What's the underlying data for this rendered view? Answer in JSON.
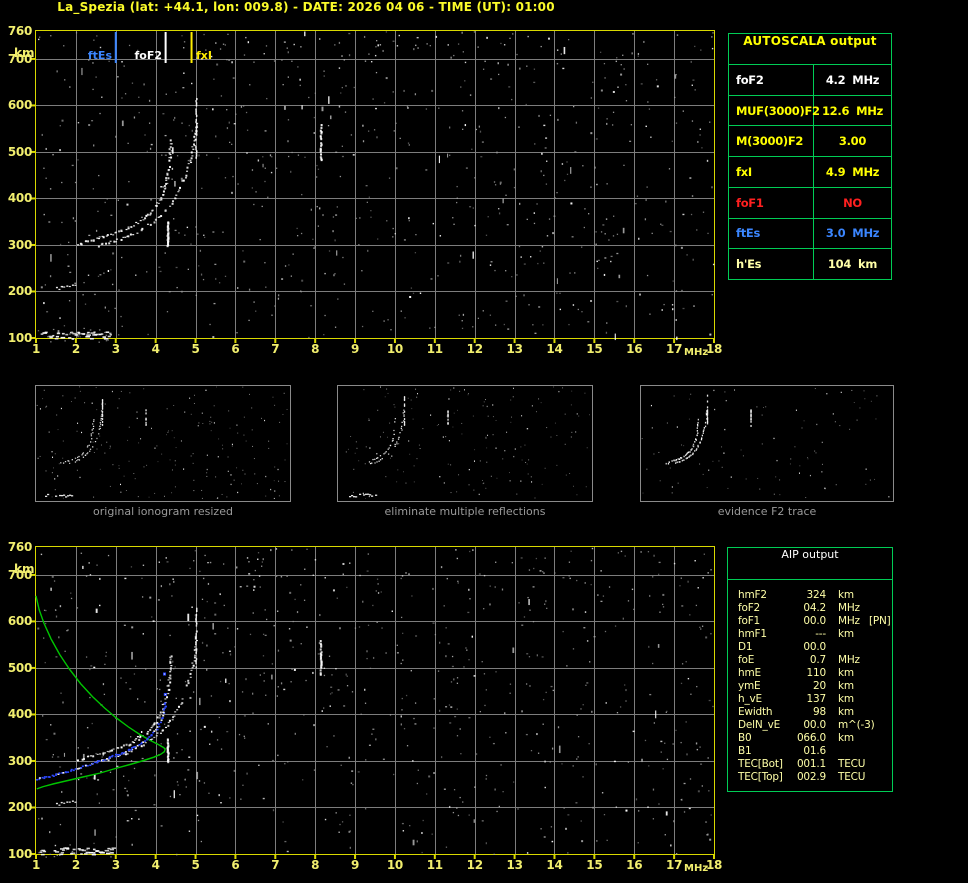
{
  "header": {
    "title": "La_Spezia (lat: +44.1, lon: 009.8) - DATE: 2026 04 06 - TIME (UT): 01:00"
  },
  "colors": {
    "background": "#000000",
    "title_yellow": "#fbfb2a",
    "axis_label_yellow": "#f1ee6e",
    "plot_border_yellow": "#d9d900",
    "grid_gray": "#7d7d7d",
    "table_border_green": "#00cc55",
    "table_yellow": "#ffff00",
    "pale_yellow": "#ffffa8",
    "alert_red": "#ff2020",
    "marker_blue": "#3b86ff",
    "profile_green": "#00c400",
    "trace_blue": "#2e49ff",
    "caption_gray": "#9a9a9a",
    "trace_white": "#ffffff"
  },
  "autoscala": {
    "title": "AUTOSCALA output",
    "rows": [
      {
        "label": "foF2",
        "value": "4.2",
        "unit": "MHz",
        "color": "#ffffff"
      },
      {
        "label": "MUF(3000)F2",
        "value": "12.6",
        "unit": "MHz",
        "color": "#ffff00"
      },
      {
        "label": "M(3000)F2",
        "value": "3.00",
        "unit": "",
        "color": "#ffff00"
      },
      {
        "label": "fxI",
        "value": "4.9",
        "unit": "MHz",
        "color": "#ffff00"
      },
      {
        "label": "foF1",
        "value": "NO",
        "unit": "",
        "color": "#ff2020"
      },
      {
        "label": "ftEs",
        "value": "3.0",
        "unit": "MHz",
        "color": "#3b86ff"
      },
      {
        "label": "h'Es",
        "value": "104",
        "unit": "km",
        "color": "#ffffa8"
      }
    ]
  },
  "aip": {
    "title": "AIP output",
    "rows": [
      {
        "label": "hmF2",
        "value": "324",
        "unit": "km",
        "note": ""
      },
      {
        "label": "foF2",
        "value": "04.2",
        "unit": "MHz",
        "note": ""
      },
      {
        "label": "foF1",
        "value": "00.0",
        "unit": "MHz",
        "note": "[PN]"
      },
      {
        "label": "hmF1",
        "value": "---",
        "unit": "km",
        "note": ""
      },
      {
        "label": "D1",
        "value": "00.0",
        "unit": "",
        "note": ""
      },
      {
        "label": "foE",
        "value": "0.7",
        "unit": "MHz",
        "note": ""
      },
      {
        "label": "hmE",
        "value": "110",
        "unit": "km",
        "note": ""
      },
      {
        "label": "ymE",
        "value": "20",
        "unit": "km",
        "note": ""
      },
      {
        "label": "h_vE",
        "value": "137",
        "unit": "km",
        "note": ""
      },
      {
        "label": "Ewidth",
        "value": "98",
        "unit": "km",
        "note": ""
      },
      {
        "label": "DelN_vE",
        "value": "00.0",
        "unit": "m^(-3)",
        "note": ""
      },
      {
        "label": "B0",
        "value": "066.0",
        "unit": "km",
        "note": ""
      },
      {
        "label": "B1",
        "value": "01.6",
        "unit": "",
        "note": ""
      },
      {
        "label": "TEC[Bot]",
        "value": "001.1",
        "unit": "TECU",
        "note": ""
      },
      {
        "label": "TEC[Top]",
        "value": "002.9",
        "unit": "TECU",
        "note": ""
      }
    ]
  },
  "thumbnails": [
    {
      "caption": "original ionogram resized"
    },
    {
      "caption": "eliminate multiple reflections"
    },
    {
      "caption": "evidence F2 trace"
    }
  ],
  "chart_data": {
    "type": "scatter",
    "x_axis": {
      "label": "MHz",
      "range": [
        1,
        18
      ],
      "ticks": [
        1,
        2,
        3,
        4,
        5,
        6,
        7,
        8,
        9,
        10,
        11,
        12,
        13,
        14,
        15,
        16,
        17,
        18
      ]
    },
    "y_axis": {
      "label": "km",
      "range": [
        100,
        760
      ],
      "ticks": [
        760,
        700,
        600,
        500,
        400,
        300,
        200,
        100
      ],
      "gridlines_km": [
        200,
        300,
        400,
        500,
        600,
        700
      ]
    },
    "top_plot": {
      "name": "scaled ionogram with AUTOSCALA markers",
      "markers": [
        {
          "label": "ftEs",
          "freq_mhz": 3.0,
          "color": "#3b86ff",
          "label_side": "left"
        },
        {
          "label": "foF2",
          "freq_mhz": 4.25,
          "color": "#ffffff",
          "label_side": "left"
        },
        {
          "label": "fxI",
          "freq_mhz": 4.9,
          "color": "#ffee00",
          "label_side": "right"
        }
      ],
      "series": {
        "f2_ordinary_trace": [
          [
            2.05,
            304
          ],
          [
            2.3,
            309
          ],
          [
            2.6,
            316
          ],
          [
            2.9,
            324
          ],
          [
            3.2,
            334
          ],
          [
            3.5,
            347
          ],
          [
            3.75,
            362
          ],
          [
            3.95,
            380
          ],
          [
            4.1,
            400
          ],
          [
            4.2,
            424
          ],
          [
            4.28,
            452
          ],
          [
            4.33,
            483
          ],
          [
            4.36,
            512
          ],
          [
            4.38,
            530
          ]
        ],
        "f2_extraordinary_trace": [
          [
            2.55,
            301
          ],
          [
            2.85,
            307
          ],
          [
            3.15,
            315
          ],
          [
            3.45,
            326
          ],
          [
            3.75,
            340
          ],
          [
            4.0,
            356
          ],
          [
            4.25,
            376
          ],
          [
            4.45,
            400
          ],
          [
            4.62,
            428
          ],
          [
            4.76,
            458
          ],
          [
            4.87,
            490
          ],
          [
            4.94,
            520
          ],
          [
            4.98,
            548
          ],
          [
            5.0,
            565
          ]
        ],
        "x_trace_asymptote": {
          "freq_mhz": 5.02,
          "h_km": [
            490,
            632
          ]
        },
        "es_layer_trace": {
          "h_km": 107,
          "freq_range_mhz": [
            1.02,
            2.88
          ]
        },
        "second_echo_dots": [
          [
            1.5,
            210
          ],
          [
            1.62,
            212
          ],
          [
            1.76,
            213
          ],
          [
            1.9,
            215
          ]
        ],
        "vertical_echo": {
          "freq_mhz": 4.31,
          "h_km": [
            300,
            352
          ]
        },
        "interference_line": {
          "freq_mhz": 8.15,
          "h_km": [
            485,
            560
          ]
        }
      }
    },
    "bottom_plot": {
      "name": "restored trace and electron density profile",
      "electron_density_profile_green": [
        [
          1.0,
          655
        ],
        [
          1.08,
          625
        ],
        [
          1.2,
          596
        ],
        [
          1.38,
          562
        ],
        [
          1.6,
          528
        ],
        [
          1.85,
          496
        ],
        [
          2.12,
          466
        ],
        [
          2.42,
          438
        ],
        [
          2.72,
          414
        ],
        [
          3.02,
          392
        ],
        [
          3.32,
          373
        ],
        [
          3.6,
          357
        ],
        [
          3.85,
          345
        ],
        [
          4.05,
          336
        ],
        [
          4.18,
          330
        ],
        [
          4.24,
          326
        ],
        [
          4.22,
          320
        ],
        [
          4.12,
          314
        ],
        [
          3.95,
          308
        ],
        [
          3.7,
          301
        ],
        [
          3.38,
          293
        ],
        [
          3.0,
          284
        ],
        [
          2.6,
          274
        ],
        [
          2.2,
          266
        ],
        [
          1.8,
          258
        ],
        [
          1.45,
          251
        ],
        [
          1.18,
          245
        ],
        [
          1.02,
          240
        ]
      ],
      "restored_trace_blue": [
        [
          1.0,
          262
        ],
        [
          1.25,
          267
        ],
        [
          1.5,
          272
        ],
        [
          1.75,
          278
        ],
        [
          2.0,
          285
        ],
        [
          2.25,
          292
        ],
        [
          2.5,
          299
        ],
        [
          2.75,
          307
        ],
        [
          3.0,
          314
        ],
        [
          3.2,
          321
        ],
        [
          3.4,
          329
        ],
        [
          3.6,
          338
        ],
        [
          3.78,
          349
        ],
        [
          3.92,
          361
        ],
        [
          4.03,
          374
        ],
        [
          4.11,
          388
        ],
        [
          4.17,
          403
        ],
        [
          4.21,
          417
        ],
        [
          4.23,
          430
        ]
      ],
      "isolated_blue_dots": [
        [
          4.23,
          444
        ],
        [
          4.21,
          488
        ]
      ]
    }
  }
}
